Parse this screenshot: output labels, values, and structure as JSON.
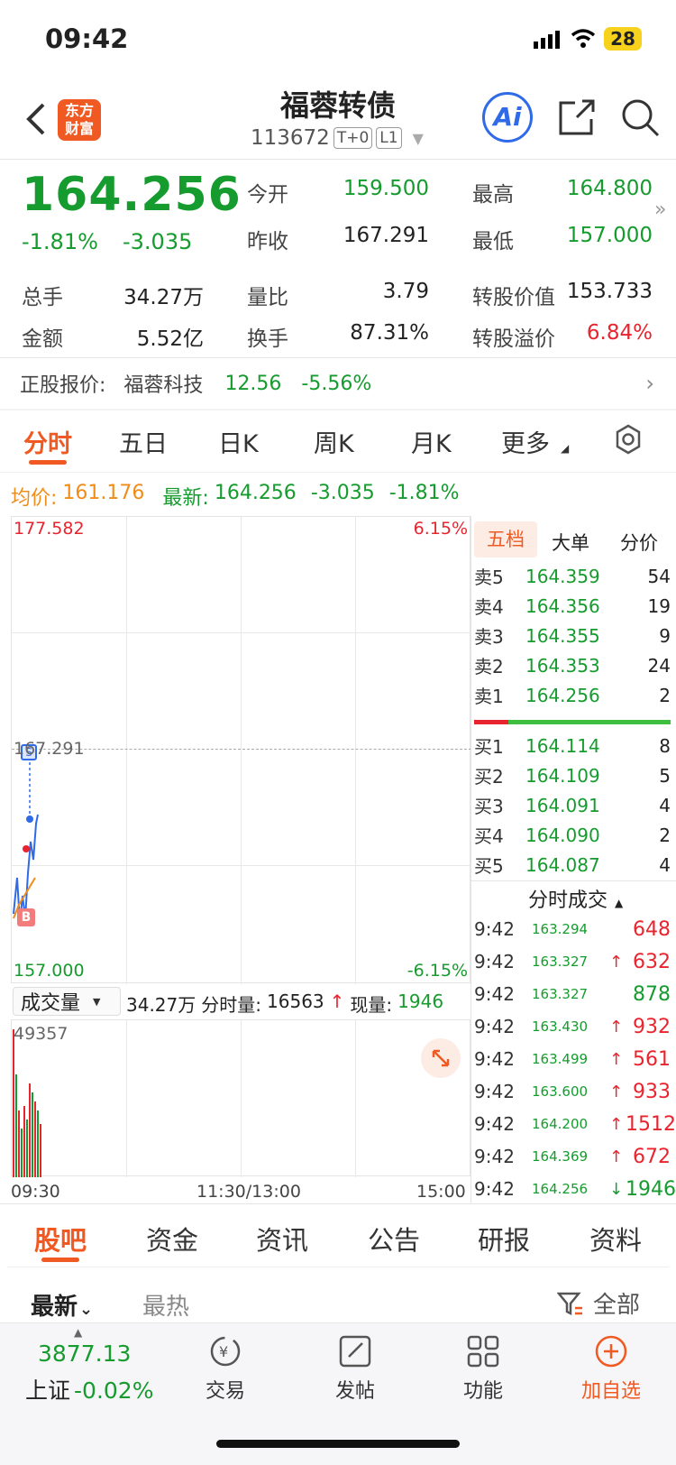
{
  "status": {
    "time": "09:42",
    "battery": "28"
  },
  "header": {
    "back_icon": "chevron-left-icon",
    "logo_line1": "东方",
    "logo_line2": "财富",
    "title": "福蓉转债",
    "code": "113672",
    "tag1": "T+0",
    "tag2": "L1",
    "ai_label": "Ai"
  },
  "quote": {
    "price": "164.256",
    "pct": "-1.81%",
    "change": "-3.035",
    "open_label": "今开",
    "open": "159.500",
    "high_label": "最高",
    "high": "164.800",
    "prev_label": "昨收",
    "prev": "167.291",
    "low_label": "最低",
    "low": "157.000",
    "vol_label": "总手",
    "vol": "34.27万",
    "ratio_label": "量比",
    "ratio": "3.79",
    "conv_val_label": "转股价值",
    "conv_val": "153.733",
    "amount_label": "金额",
    "amount": "5.52亿",
    "turnover_label": "换手",
    "turnover": "87.31%",
    "premium_label": "转股溢价",
    "premium": "6.84%"
  },
  "stock_row": {
    "label": "正股报价:",
    "name": "福蓉科技",
    "price": "12.56",
    "pct": "-5.56%"
  },
  "tabs": [
    "分时",
    "五日",
    "日K",
    "周K",
    "月K",
    "更多"
  ],
  "chart_info": {
    "avg_label": "均价:",
    "avg": "161.176",
    "latest_label": "最新:",
    "latest": "164.256",
    "latest_change": "-3.035",
    "latest_pct": "-1.81%",
    "max": "177.582",
    "max_pct": "6.15%",
    "min": "157.000",
    "min_pct": "-6.15%",
    "ref": "167.291",
    "vol_selector": "成交量",
    "vol_total": "34.27万",
    "vol_min_label": "分时量:",
    "vol_min": "16563",
    "vol_now_label": "现量:",
    "vol_now": "1946",
    "vol_max": "49357",
    "t_start": "09:30",
    "t_mid": "11:30/13:00",
    "t_end": "15:00"
  },
  "order_book": {
    "tabs": [
      "五档",
      "大单",
      "分价"
    ],
    "asks": [
      {
        "label": "卖5",
        "price": "164.359",
        "vol": "54"
      },
      {
        "label": "卖4",
        "price": "164.356",
        "vol": "19"
      },
      {
        "label": "卖3",
        "price": "164.355",
        "vol": "9"
      },
      {
        "label": "卖2",
        "price": "164.353",
        "vol": "24"
      },
      {
        "label": "卖1",
        "price": "164.256",
        "vol": "2"
      }
    ],
    "bids": [
      {
        "label": "买1",
        "price": "164.114",
        "vol": "8"
      },
      {
        "label": "买2",
        "price": "164.109",
        "vol": "5"
      },
      {
        "label": "买3",
        "price": "164.091",
        "vol": "4"
      },
      {
        "label": "买4",
        "price": "164.090",
        "vol": "2"
      },
      {
        "label": "买5",
        "price": "164.087",
        "vol": "4"
      }
    ],
    "trades_title": "分时成交",
    "trades": [
      {
        "time": "9:42",
        "price": "163.294",
        "dir": "",
        "vol": "648",
        "color": "red"
      },
      {
        "time": "9:42",
        "price": "163.327",
        "dir": "↑",
        "vol": "632",
        "color": "red"
      },
      {
        "time": "9:42",
        "price": "163.327",
        "dir": "",
        "vol": "878",
        "color": "green"
      },
      {
        "time": "9:42",
        "price": "163.430",
        "dir": "↑",
        "vol": "932",
        "color": "red"
      },
      {
        "time": "9:42",
        "price": "163.499",
        "dir": "↑",
        "vol": "561",
        "color": "red"
      },
      {
        "time": "9:42",
        "price": "163.600",
        "dir": "↑",
        "vol": "933",
        "color": "red"
      },
      {
        "time": "9:42",
        "price": "164.200",
        "dir": "↑",
        "vol": "1512",
        "color": "red"
      },
      {
        "time": "9:42",
        "price": "164.369",
        "dir": "↑",
        "vol": "672",
        "color": "red"
      },
      {
        "time": "9:42",
        "price": "164.256",
        "dir": "↓",
        "vol": "1946",
        "color": "green"
      }
    ]
  },
  "bottom_tabs": [
    "股吧",
    "资金",
    "资讯",
    "公告",
    "研报",
    "资料"
  ],
  "sort": {
    "latest": "最新",
    "hot": "最热",
    "filter": "全部"
  },
  "dock": {
    "index_value": "3877.13",
    "index_name": "上证",
    "index_pct": "-0.02%",
    "trade": "交易",
    "post": "发帖",
    "func": "功能",
    "add": "加自选"
  },
  "colors": {
    "up": "#e8242f",
    "down": "#169b2e",
    "accent": "#f05a22",
    "avg": "#f08c1a"
  }
}
